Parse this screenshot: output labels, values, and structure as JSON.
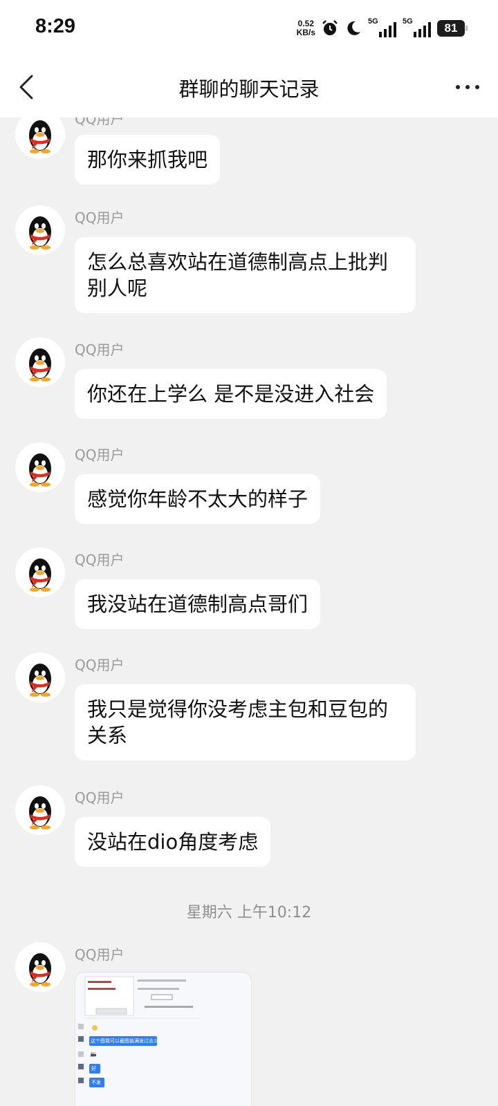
{
  "status_bar": {
    "time": "8:29",
    "net_speed_value": "0.52",
    "net_speed_unit": "KB/s",
    "signal1_label": "5G",
    "signal2_label": "5G",
    "battery": "81"
  },
  "header": {
    "title": "群聊的聊天记录"
  },
  "messages": [
    {
      "sender": "QQ用户",
      "text": "那你来抓我吧"
    },
    {
      "sender": "QQ用户",
      "text": "怎么总喜欢站在道德制高点上批判别人呢"
    },
    {
      "sender": "QQ用户",
      "text": "你还在上学么 是不是没进入社会"
    },
    {
      "sender": "QQ用户",
      "text": "感觉你年龄不太大的样子"
    },
    {
      "sender": "QQ用户",
      "text": "我没站在道德制高点哥们"
    },
    {
      "sender": "QQ用户",
      "text": "我只是觉得你没考虑主包和豆包的关系"
    },
    {
      "sender": "QQ用户",
      "text": "没站在dio角度考虑"
    }
  ],
  "time_separator": "星期六 上午10:12",
  "image_message": {
    "sender": "QQ用户",
    "screenshot_lines": [
      "这个图我可以截图装满发过去么",
      "别",
      "好",
      "不发"
    ]
  },
  "colors": {
    "background": "#f1f1f1",
    "bubble": "#ffffff",
    "accent_blue": "#2e7cf6"
  }
}
